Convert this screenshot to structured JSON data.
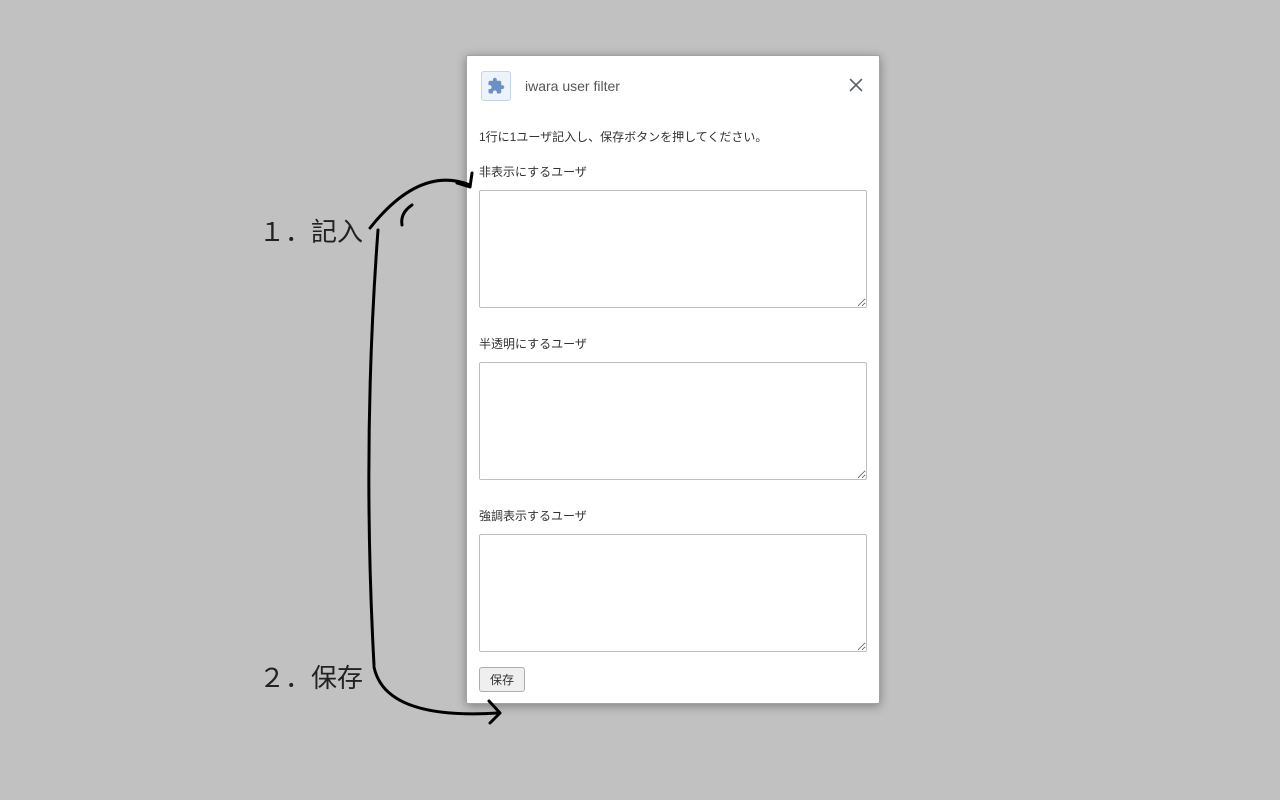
{
  "dialog": {
    "title": "iwara user filter",
    "instructions": "1行に1ユーザ記入し、保存ボタンを押してください。",
    "fields": [
      {
        "label": "非表示にするユーザ",
        "value": ""
      },
      {
        "label": "半透明にするユーザ",
        "value": ""
      },
      {
        "label": "強調表示するユーザ",
        "value": ""
      }
    ],
    "save_button_label": "保存"
  },
  "annotations": {
    "step1": "１．記入",
    "step2": "２．保存"
  }
}
